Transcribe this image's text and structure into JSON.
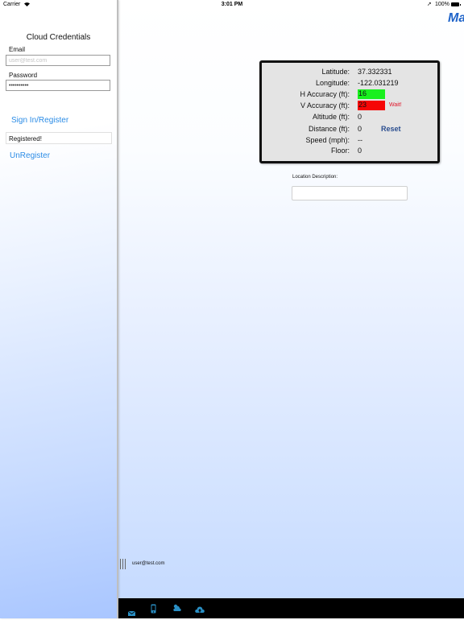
{
  "status_bar": {
    "carrier": "Carrier",
    "time": "3:01 PM",
    "battery": "100%"
  },
  "sidebar": {
    "title": "Cloud Credentials",
    "email_label": "Email",
    "email_placeholder": "user@test.com",
    "password_label": "Password",
    "password_value": "••••••••••",
    "sign_in_label": "Sign In/Register",
    "status_text": "Registered!",
    "unregister_label": "UnRegister"
  },
  "app": {
    "logo_text": "Ma"
  },
  "info": {
    "latitude_label": "Latitude:",
    "latitude_value": "37.332331",
    "longitude_label": "Longitude:",
    "longitude_value": "-122.031219",
    "h_accuracy_label": "H Accuracy (ft):",
    "h_accuracy_value": "16",
    "v_accuracy_label": "V Accuracy (ft):",
    "v_accuracy_value": "23",
    "wait_text": "Wait!",
    "altitude_label": "Altitude (ft):",
    "altitude_value": "0",
    "distance_label": "Distance (ft):",
    "distance_value": "0",
    "reset_label": "Reset",
    "speed_label": "Speed (mph):",
    "speed_value": "--",
    "floor_label": "Floor:",
    "floor_value": "0"
  },
  "location": {
    "label": "Location Description:",
    "value": ""
  },
  "footer": {
    "user_email": "user@test.com"
  },
  "bottom_bar": {
    "icons": [
      "mail-icon",
      "device-icon",
      "cloud-sun-icon",
      "cloud-upload-icon"
    ]
  },
  "colors": {
    "accent": "#2b8ce6",
    "good": "#19f01e",
    "bad": "#f60606",
    "warning_text": "#e0172b"
  }
}
